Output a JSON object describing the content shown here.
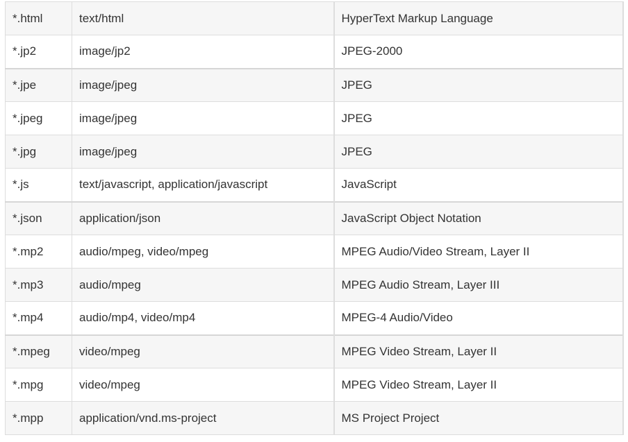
{
  "table": {
    "rows": [
      {
        "ext": "*.html",
        "mime": "text/html",
        "desc": "HyperText Markup Language"
      },
      {
        "ext": "*.jp2",
        "mime": "image/jp2",
        "desc": "JPEG-2000"
      },
      {
        "ext": "*.jpe",
        "mime": "image/jpeg",
        "desc": "JPEG"
      },
      {
        "ext": "*.jpeg",
        "mime": "image/jpeg",
        "desc": "JPEG"
      },
      {
        "ext": "*.jpg",
        "mime": "image/jpeg",
        "desc": "JPEG"
      },
      {
        "ext": "*.js",
        "mime": "text/javascript, application/javascript",
        "desc": "JavaScript"
      },
      {
        "ext": "*.json",
        "mime": "application/json",
        "desc": "JavaScript Object Notation"
      },
      {
        "ext": "*.mp2",
        "mime": "audio/mpeg, video/mpeg",
        "desc": "MPEG Audio/Video Stream, Layer II"
      },
      {
        "ext": "*.mp3",
        "mime": "audio/mpeg",
        "desc": "MPEG Audio Stream, Layer III"
      },
      {
        "ext": "*.mp4",
        "mime": "audio/mp4, video/mp4",
        "desc": "MPEG-4 Audio/Video"
      },
      {
        "ext": "*.mpeg",
        "mime": "video/mpeg",
        "desc": "MPEG Video Stream, Layer II"
      },
      {
        "ext": "*.mpg",
        "mime": "video/mpeg",
        "desc": "MPEG Video Stream, Layer II"
      },
      {
        "ext": "*.mpp",
        "mime": "application/vnd.ms-project",
        "desc": "MS Project Project"
      }
    ]
  }
}
